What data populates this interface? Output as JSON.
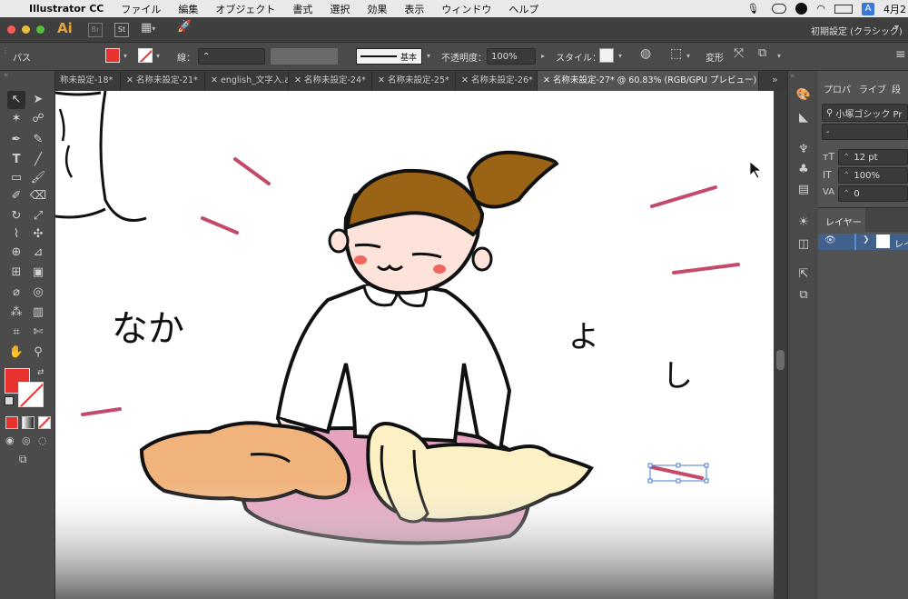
{
  "menubar": {
    "app_name": "Illustrator CC",
    "items": [
      "ファイル",
      "編集",
      "オブジェクト",
      "書式",
      "選択",
      "効果",
      "表示",
      "ウィンドウ",
      "ヘルプ"
    ],
    "clock": "4月2",
    "input_badge": "A"
  },
  "appbar": {
    "logo": "Ai",
    "br": "Br",
    "st": "St",
    "workspace": "初期設定 (クラシック)"
  },
  "control": {
    "selection_type": "パス",
    "stroke_label": "線：",
    "brush_label": "基本",
    "opacity_label": "不透明度：",
    "opacity_value": "100%",
    "style_label": "スタイル：",
    "transform_label": "変形",
    "fill_color": "#e8322e"
  },
  "tabs": [
    {
      "label": "称未設定-18*"
    },
    {
      "label": "名称未設定-21*"
    },
    {
      "label": "english_文字入.ai"
    },
    {
      "label": "名称未設定-24*"
    },
    {
      "label": "名称未設定-25*"
    },
    {
      "label": "名称未設定-26*"
    },
    {
      "label": "名称未設定-27* @ 60.83% (RGB/GPU プレビュー)"
    }
  ],
  "canvas": {
    "text_naka": "なか",
    "text_yo": "よ",
    "text_shi": "し"
  },
  "panel": {
    "tab_props": "プロパ",
    "tab_library": "ライブ",
    "tab_para": "段",
    "font_name": "小塚ゴシック Pr",
    "font_style": "-",
    "font_size": "12 pt",
    "leading": "100%",
    "tracking": "0",
    "layers_title": "レイヤー",
    "layer_name": "レイ"
  }
}
